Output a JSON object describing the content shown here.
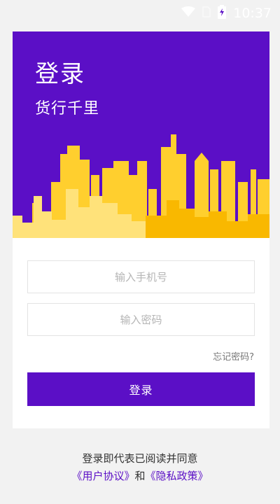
{
  "status_bar": {
    "time": "10:37",
    "icons": [
      "wifi-icon",
      "sim-icon",
      "battery-charging-icon"
    ]
  },
  "hero": {
    "title": "登录",
    "subtitle": "货行千里",
    "colors": {
      "background": "#5b0fc6",
      "skyline_light": "#ffe27a",
      "skyline_mid": "#ffcf2e",
      "skyline_dark": "#f9b800"
    }
  },
  "form": {
    "phone_placeholder": "输入手机号",
    "password_placeholder": "输入密码",
    "forgot_label": "忘记密码?",
    "login_label": "登录"
  },
  "footer": {
    "agree_text": "登录即代表已阅读并同意",
    "user_agreement": "《用户协议》",
    "and": "和",
    "privacy_policy": "《隐私政策》"
  },
  "colors": {
    "accent": "#5b0fc6",
    "page_background": "#f2f2f2"
  }
}
